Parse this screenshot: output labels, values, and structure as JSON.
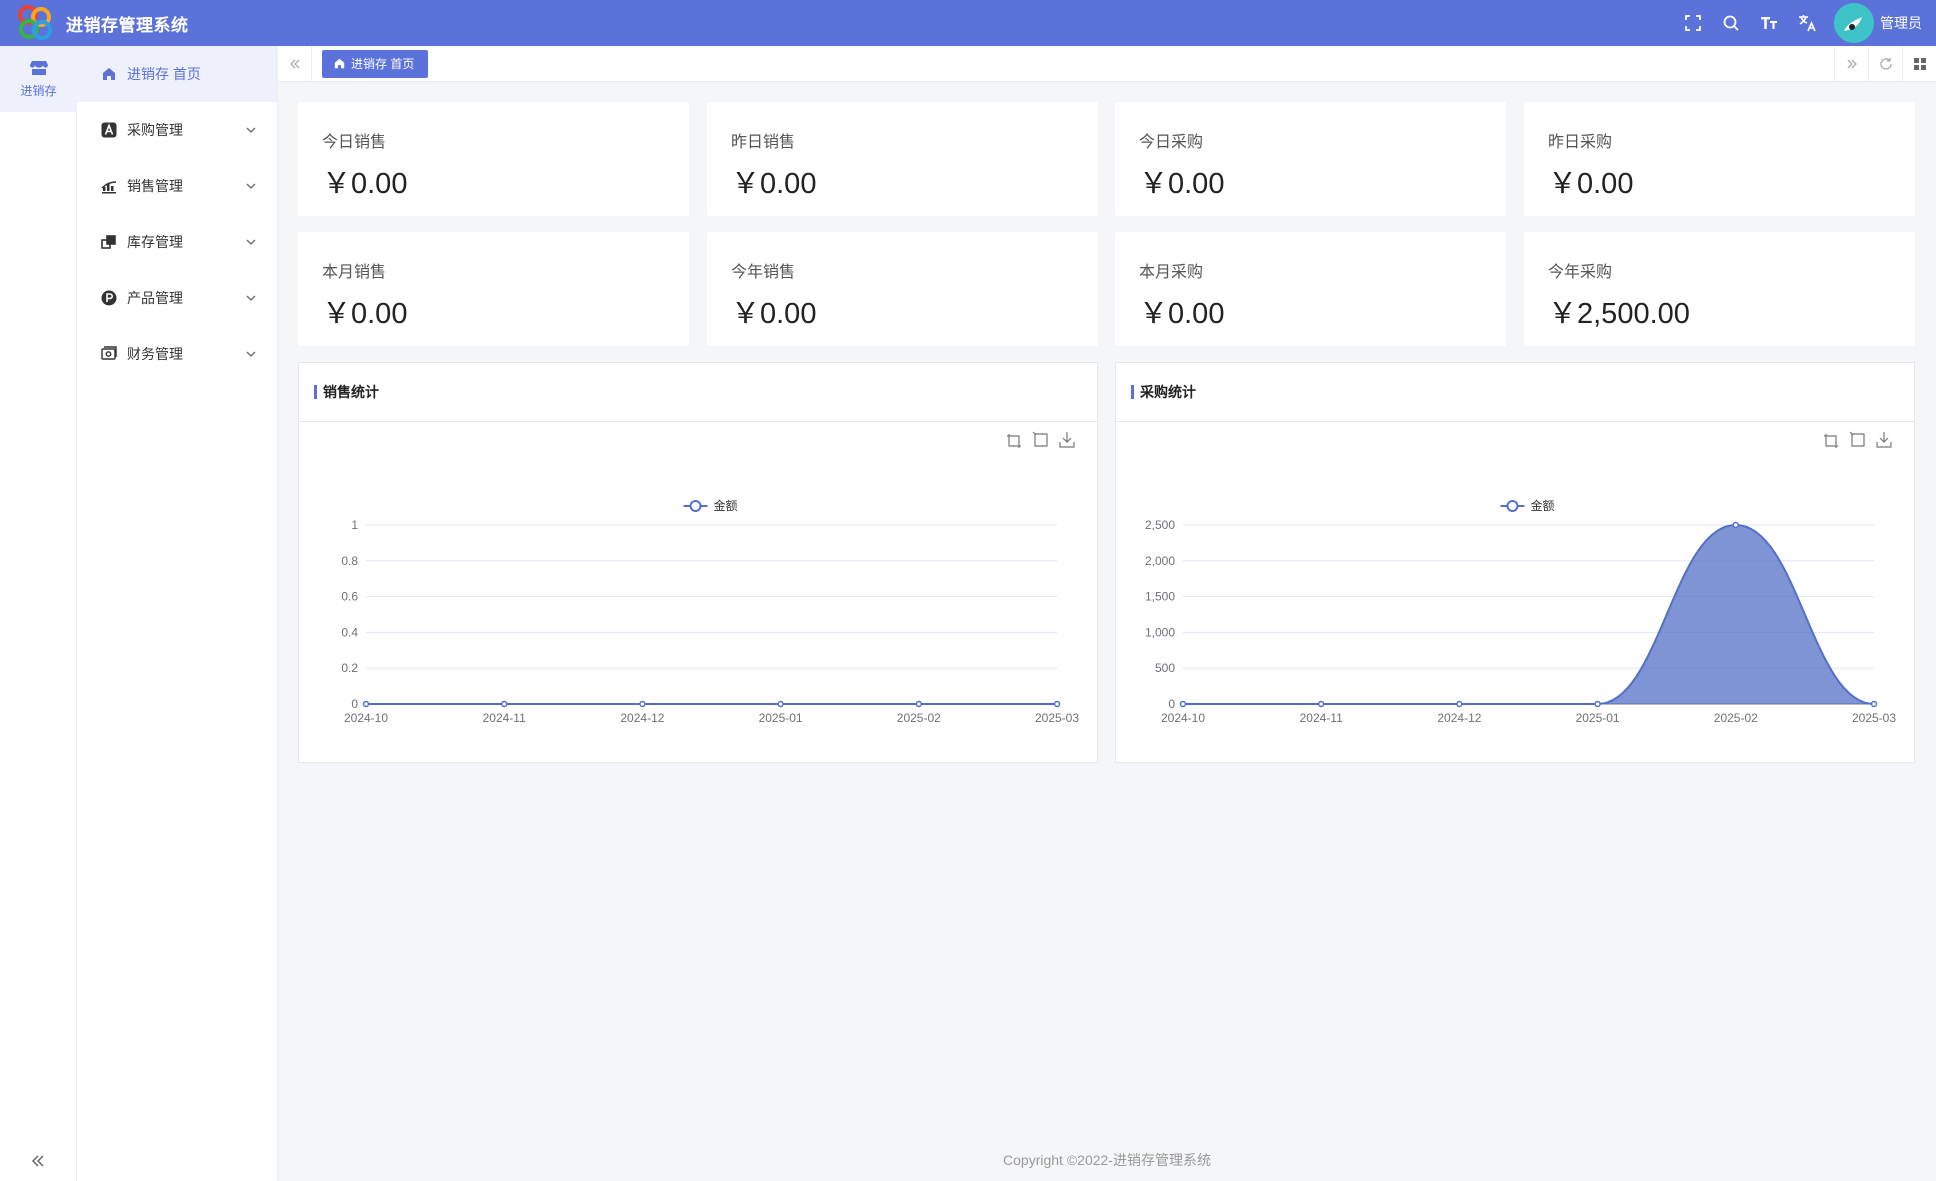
{
  "header": {
    "app_title": "进销存管理系统",
    "user_name": "管理员",
    "icons": [
      "fullscreen-icon",
      "search-icon",
      "font-size-icon",
      "translate-icon"
    ]
  },
  "rail": {
    "label": "进销存"
  },
  "menu": {
    "items": [
      {
        "label": "进销存 首页",
        "icon": "home-icon",
        "active": true
      },
      {
        "label": "采购管理",
        "icon": "purchase-icon"
      },
      {
        "label": "销售管理",
        "icon": "sales-icon"
      },
      {
        "label": "库存管理",
        "icon": "inventory-icon"
      },
      {
        "label": "产品管理",
        "icon": "product-icon"
      },
      {
        "label": "财务管理",
        "icon": "finance-icon"
      }
    ]
  },
  "tabs": {
    "active_label": "进销存 首页"
  },
  "stats": [
    {
      "label": "今日销售",
      "value": "￥0.00"
    },
    {
      "label": "昨日销售",
      "value": "￥0.00"
    },
    {
      "label": "今日采购",
      "value": "￥0.00"
    },
    {
      "label": "昨日采购",
      "value": "￥0.00"
    },
    {
      "label": "本月销售",
      "value": "￥0.00"
    },
    {
      "label": "今年销售",
      "value": "￥0.00"
    },
    {
      "label": "本月采购",
      "value": "￥0.00"
    },
    {
      "label": "今年采购",
      "value": "￥2,500.00"
    }
  ],
  "panels": {
    "sales_title": "销售统计",
    "purchase_title": "采购统计"
  },
  "chart_data": [
    {
      "type": "line",
      "title": "销售统计",
      "categories": [
        "2024-10",
        "2024-11",
        "2024-12",
        "2025-01",
        "2025-02",
        "2025-03"
      ],
      "series": [
        {
          "name": "金额",
          "values": [
            0,
            0,
            0,
            0,
            0,
            0
          ]
        }
      ],
      "yticks": [
        "0",
        "0.2",
        "0.4",
        "0.6",
        "0.8",
        "1"
      ],
      "ylim": [
        0,
        1
      ],
      "legend": "top-center",
      "grid": true,
      "color": "#5470c6"
    },
    {
      "type": "area",
      "title": "采购统计",
      "categories": [
        "2024-10",
        "2024-11",
        "2024-12",
        "2025-01",
        "2025-02",
        "2025-03"
      ],
      "series": [
        {
          "name": "金额",
          "values": [
            0,
            0,
            0,
            0,
            2500,
            0
          ]
        }
      ],
      "yticks": [
        "0",
        "500",
        "1,000",
        "1,500",
        "2,000",
        "2,500"
      ],
      "ylim": [
        0,
        2500
      ],
      "legend": "top-center",
      "grid": true,
      "color": "#5470c6"
    }
  ],
  "footer": {
    "text": "Copyright ©2022-进销存管理系统"
  }
}
